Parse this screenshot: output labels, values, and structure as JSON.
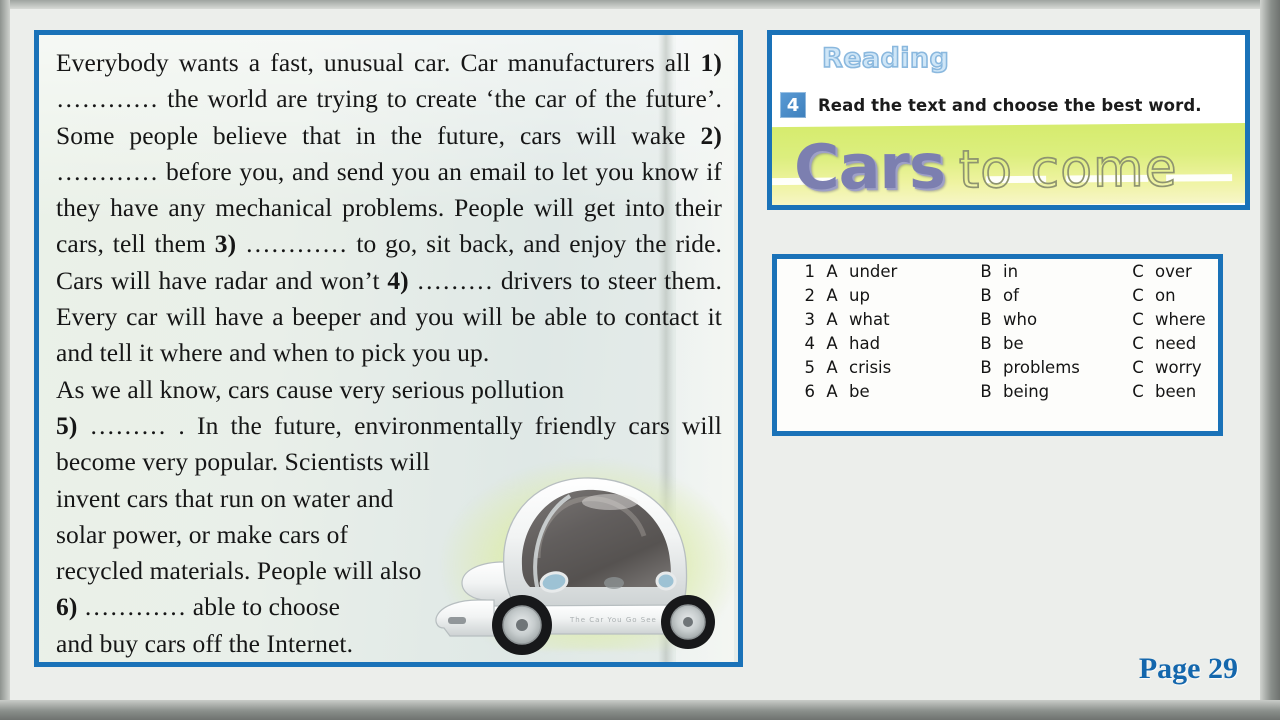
{
  "document": {
    "page_label": "Page 29"
  },
  "reading_text": {
    "paragraph_1": [
      {
        "plain": "Everybody wants a fast, unusual car. Car manufacturers all "
      },
      {
        "bold": "1)"
      },
      {
        "plain": " …………   the world are trying to create ‘the car of the future’. Some people believe that in the future, cars will wake "
      },
      {
        "bold": "2)"
      },
      {
        "plain": " ………… before you, and send you an email to let you know if they have any mechanical problems. People will get into their cars, tell them "
      },
      {
        "bold": "3)"
      },
      {
        "plain": " ………… to go, sit back, and enjoy the ride. Cars will have radar and won’t "
      },
      {
        "bold": "4)"
      },
      {
        "plain": " ……… drivers to steer them. Every car will have a beeper and you will be able to contact it and tell it where and when to pick you up."
      }
    ],
    "paragraph_2_head": "As  we  all  know,  cars  cause  very  serious  pollution",
    "paragraph_2_rest": [
      {
        "bold": "5)"
      },
      {
        "plain": " ……… . In the future, environmentally friendly cars will become very popular. Scientists will"
      }
    ],
    "narrow_lines": [
      "invent cars that run on water and",
      "solar power, or make cars of",
      "recycled materials. People will also"
    ],
    "final_line": [
      {
        "bold": "6)"
      },
      {
        "plain": " ………… able to choose"
      }
    ],
    "closing_line": "and buy cars off the Internet."
  },
  "reading_box": {
    "section_title": "Reading",
    "task_number": "4",
    "instruction": "Read the text and choose the best word.",
    "headline_main": "Cars",
    "headline_tail": "to come"
  },
  "options": {
    "rows": [
      {
        "num": "1",
        "a_letter": "A",
        "a_word": "under",
        "b_letter": "B",
        "b_word": "in",
        "c_letter": "C",
        "c_word": "over"
      },
      {
        "num": "2",
        "a_letter": "A",
        "a_word": "up",
        "b_letter": "B",
        "b_word": "of",
        "c_letter": "C",
        "c_word": "on"
      },
      {
        "num": "3",
        "a_letter": "A",
        "a_word": "what",
        "b_letter": "B",
        "b_word": "who",
        "c_letter": "C",
        "c_word": "where"
      },
      {
        "num": "4",
        "a_letter": "A",
        "a_word": "had",
        "b_letter": "B",
        "b_word": "be",
        "c_letter": "C",
        "c_word": "need"
      },
      {
        "num": "5",
        "a_letter": "A",
        "a_word": "crisis",
        "b_letter": "B",
        "b_word": "problems",
        "c_letter": "C",
        "c_word": "worry"
      },
      {
        "num": "6",
        "a_letter": "A",
        "a_word": "be",
        "b_letter": "B",
        "b_word": "being",
        "c_letter": "C",
        "c_word": "been"
      }
    ]
  },
  "colors": {
    "panel_border_blue": "#1a72b8",
    "task_badge_blue": "#4a8ecb",
    "headline_purple": "#7c7fb0",
    "banner_green": "#d6ec6e",
    "page_number_blue": "#1467ad",
    "frame_gray": "#9aa09c"
  }
}
